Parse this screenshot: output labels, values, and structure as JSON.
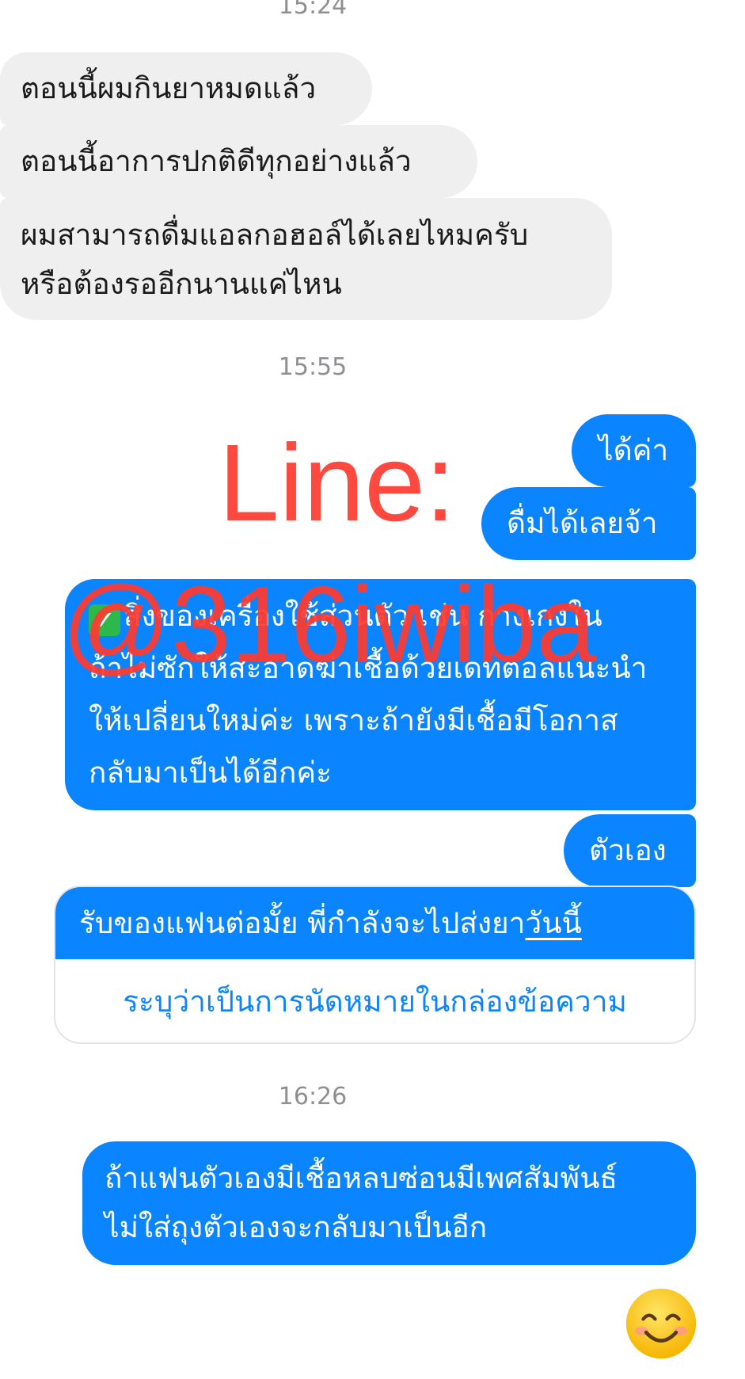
{
  "timestamps": {
    "t1": "15:24",
    "t2": "15:55",
    "t3": "16:26"
  },
  "incoming": {
    "m1": "ตอนนี้ผมกินยาหมดแล้ว",
    "m2": "ตอนนี้อาการปกติดีทุกอย่างแล้ว",
    "m3_line1": "ผมสามารถดื่มแอลกอฮอล์ได้เลยไหมครับ",
    "m3_line2": "หรือต้องรออีกนานแค่ไหน"
  },
  "outgoing": {
    "m1": "ได้ค่า",
    "m2": "ดื่มได้เลยจ้า",
    "m3_line1": "สิ่งของเครื่องใช้ส่วนตัว เช่น กางเกงใน",
    "m3_line2": "ถ้าไม่ซักให้สะอาดฆ่าเชื้อด้วยเดทตอลแนะนำ",
    "m3_line3": "ให้เปลี่ยนใหม่ค่ะ เพราะถ้ายังมีเชื้อมีโอกาส",
    "m3_line4": "กลับมาเป็นได้อีกค่ะ",
    "m4": "ตัวเอง",
    "m5_text": "รับของแฟนต่อมั้ย พี่กำลังจะไปส่งยา",
    "m5_link": "วันนี้",
    "m5_action": "ระบุว่าเป็นการนัดหมายในกล่องข้อความ",
    "m6_line1": "ถ้าแฟนตัวเองมีเชื้อหลบซ่อนมีเพศสัมพันธ์",
    "m6_line2": "ไม่ใส่ถุงตัวเองจะกลับมาเป็นอีก"
  },
  "watermark": {
    "line1": "Line:",
    "line2": "@316iwiba"
  },
  "colors": {
    "outgoing_bubble": "#0a84ff",
    "incoming_bubble": "#efefef",
    "watermark": "#ff3b30",
    "timestamp": "#8e8e93"
  },
  "icons": {
    "check": "white-check-mark-emoji",
    "reaction": "smiling-face-with-smiling-eyes-emoji"
  }
}
